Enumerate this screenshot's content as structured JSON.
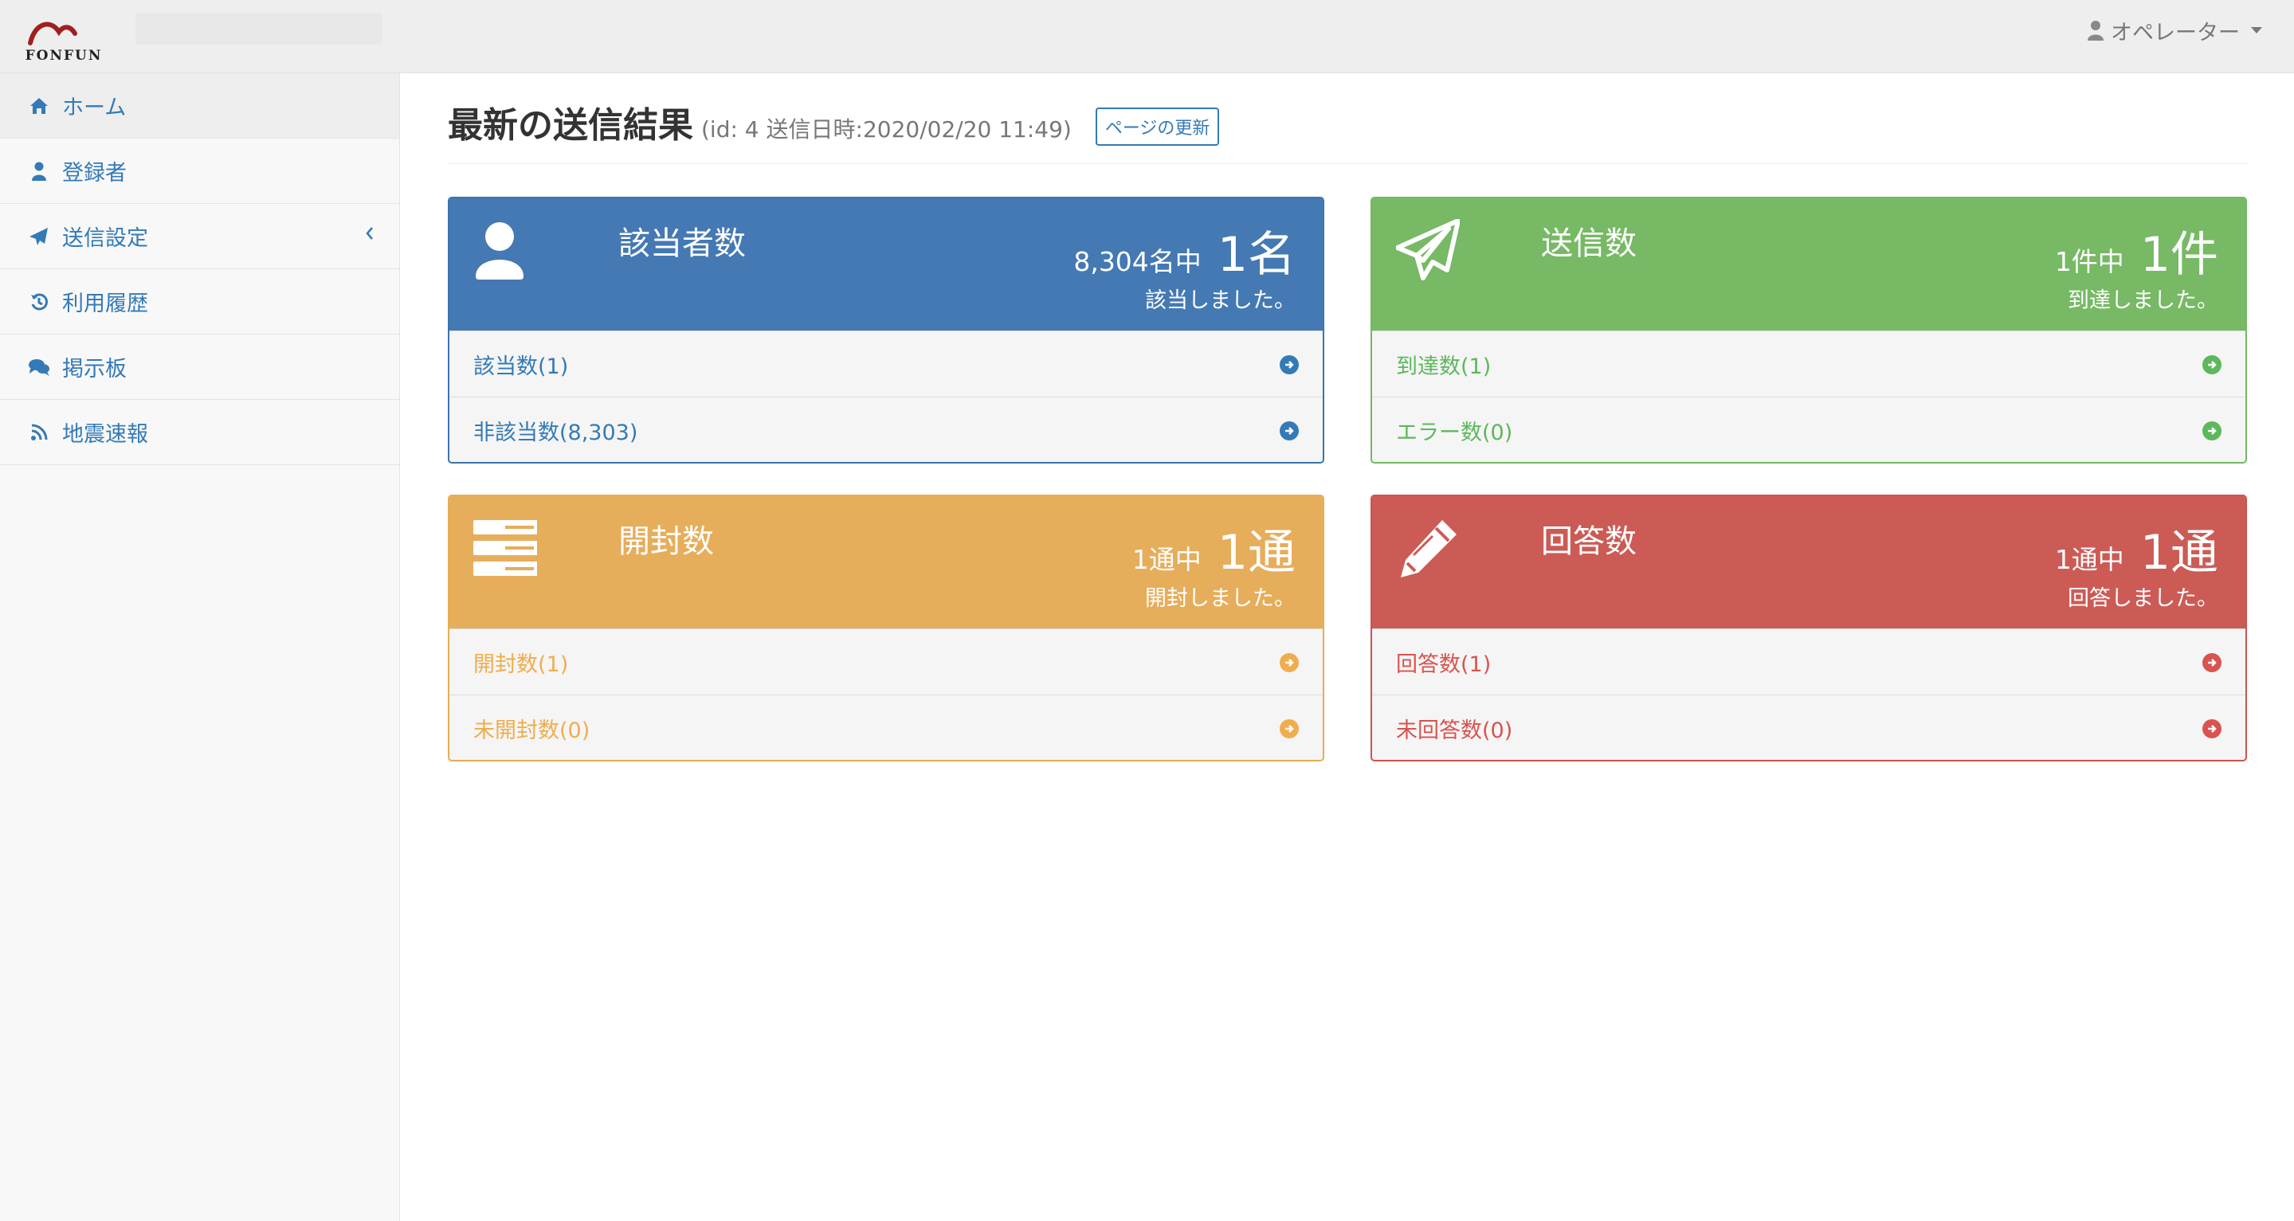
{
  "brand": {
    "logo_text": "FONFUN"
  },
  "header": {
    "user_label": "オペレーター"
  },
  "sidebar": {
    "items": [
      {
        "label": "ホーム",
        "icon": "home-icon"
      },
      {
        "label": "登録者",
        "icon": "user-icon"
      },
      {
        "label": "送信設定",
        "icon": "send-icon"
      },
      {
        "label": "利用履歴",
        "icon": "history-icon"
      },
      {
        "label": "掲示板",
        "icon": "comments-icon"
      },
      {
        "label": "地震速報",
        "icon": "rss-icon"
      }
    ]
  },
  "main": {
    "title": "最新の送信結果",
    "subtitle": "(id: 4 送信日時:2020/02/20 11:49)",
    "refresh_label": "ページの更新",
    "panels": [
      {
        "title": "該当者数",
        "icon": "user-icon",
        "count_total": "8,304名中",
        "count_main": "1名",
        "description": "該当しました。",
        "rows": [
          {
            "label": "該当数(1)"
          },
          {
            "label": "非該当数(8,303)"
          }
        ]
      },
      {
        "title": "送信数",
        "icon": "paper-plane-icon",
        "count_total": "1件中",
        "count_main": "1件",
        "description": "到達しました。",
        "rows": [
          {
            "label": "到達数(1)"
          },
          {
            "label": "エラー数(0)"
          }
        ]
      },
      {
        "title": "開封数",
        "icon": "server-icon",
        "count_total": "1通中",
        "count_main": "1通",
        "description": "開封しました。",
        "rows": [
          {
            "label": "開封数(1)"
          },
          {
            "label": "未開封数(0)"
          }
        ]
      },
      {
        "title": "回答数",
        "icon": "pencil-icon",
        "count_total": "1通中",
        "count_main": "1通",
        "description": "回答しました。",
        "rows": [
          {
            "label": "回答数(1)"
          },
          {
            "label": "未回答数(0)"
          }
        ]
      }
    ]
  },
  "colors": {
    "primary": "#337ab7",
    "success": "#5cb85c",
    "warning": "#f0ad4e",
    "danger": "#d9534f"
  }
}
